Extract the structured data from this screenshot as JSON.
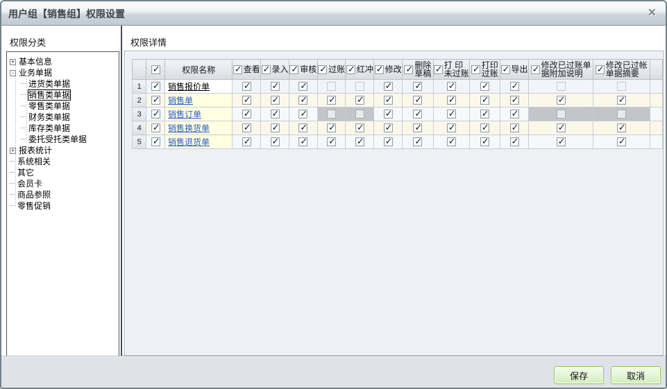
{
  "window": {
    "title": "用户组【销售组】权限设置",
    "close_icon": "×"
  },
  "left_panel": {
    "header": "权限分类",
    "tree": [
      {
        "id": "basic-info",
        "label": "基本信息",
        "level": 0,
        "expander": "plus"
      },
      {
        "id": "business-docs",
        "label": "业务单据",
        "level": 0,
        "expander": "minus"
      },
      {
        "id": "purchase-docs",
        "label": "进货类单据",
        "level": 1
      },
      {
        "id": "sales-docs",
        "label": "销售类单据",
        "level": 1,
        "selected": true
      },
      {
        "id": "retail-docs",
        "label": "零售类单据",
        "level": 1
      },
      {
        "id": "finance-docs",
        "label": "财务类单据",
        "level": 1
      },
      {
        "id": "inventory-docs",
        "label": "库存类单据",
        "level": 1
      },
      {
        "id": "consign-docs",
        "label": "委托受托类单据",
        "level": 1
      },
      {
        "id": "report-stats",
        "label": "报表统计",
        "level": 0,
        "expander": "plus"
      },
      {
        "id": "system-related",
        "label": "系统相关",
        "level": 0
      },
      {
        "id": "other",
        "label": "其它",
        "level": 0
      },
      {
        "id": "member-card",
        "label": "会员卡",
        "level": 0
      },
      {
        "id": "goods-reference",
        "label": "商品参照",
        "level": 0
      },
      {
        "id": "retail-promotion",
        "label": "零售促销",
        "level": 0
      }
    ]
  },
  "right_panel": {
    "header": "权限详情"
  },
  "table": {
    "select_all_checked": true,
    "name_header": "权限名称",
    "columns": [
      {
        "id": "view",
        "lines": [
          "查看"
        ],
        "checked": true
      },
      {
        "id": "entry",
        "lines": [
          "录入"
        ],
        "checked": true
      },
      {
        "id": "audit",
        "lines": [
          "审核"
        ],
        "checked": true
      },
      {
        "id": "post",
        "lines": [
          "过账"
        ],
        "checked": true
      },
      {
        "id": "reverse",
        "lines": [
          "红冲"
        ],
        "checked": true
      },
      {
        "id": "modify",
        "lines": [
          "修改"
        ],
        "checked": true
      },
      {
        "id": "delete-draft",
        "lines": [
          "删除",
          "草稿"
        ],
        "checked": true
      },
      {
        "id": "print-unposted",
        "lines": [
          "打 印",
          "未过账"
        ],
        "checked": true
      },
      {
        "id": "print-posted",
        "lines": [
          "打印",
          "过账"
        ],
        "checked": true
      },
      {
        "id": "export",
        "lines": [
          "导出"
        ],
        "checked": true
      },
      {
        "id": "modify-posted-note",
        "lines": [
          "修改已过账单",
          "据附加说明"
        ],
        "checked": true
      },
      {
        "id": "modify-posted-summary",
        "lines": [
          "修改已过帐",
          "单据摘要"
        ],
        "checked": true
      }
    ],
    "rows": [
      {
        "num": "1",
        "name": "销售报价单",
        "current": true,
        "row_checked": true,
        "cells": [
          "c",
          "c",
          "c",
          "u",
          "u",
          "c",
          "c",
          "c",
          "c",
          "c",
          "u",
          "u"
        ]
      },
      {
        "num": "2",
        "name": "销售单",
        "current": false,
        "row_checked": true,
        "cells": [
          "c",
          "c",
          "c",
          "c",
          "c",
          "c",
          "c",
          "c",
          "c",
          "c",
          "c",
          "c"
        ]
      },
      {
        "num": "3",
        "name": "销售订单",
        "current": false,
        "row_checked": true,
        "cells": [
          "c",
          "c",
          "c",
          "g",
          "g",
          "c",
          "c",
          "c",
          "c",
          "c",
          "g",
          "g"
        ]
      },
      {
        "num": "4",
        "name": "销售换货单",
        "current": false,
        "row_checked": true,
        "cells": [
          "c",
          "c",
          "c",
          "c",
          "c",
          "c",
          "c",
          "c",
          "c",
          "c",
          "c",
          "c"
        ]
      },
      {
        "num": "5",
        "name": "销售退货单",
        "current": false,
        "row_checked": true,
        "cells": [
          "c",
          "c",
          "c",
          "c",
          "c",
          "c",
          "c",
          "c",
          "c",
          "c",
          "c",
          "c"
        ]
      }
    ]
  },
  "footer": {
    "save_label": "保存",
    "cancel_label": "取消"
  },
  "colors": {
    "link_blue": "#2b5cc5",
    "button_green_border": "#8bc558",
    "name_cell_yellow": "#ffffe1",
    "disabled_cell_grey": "#c2c5c9",
    "row_stripe_cream": "#fbf8ea",
    "row_stripe_light": "#f6f9fc"
  }
}
